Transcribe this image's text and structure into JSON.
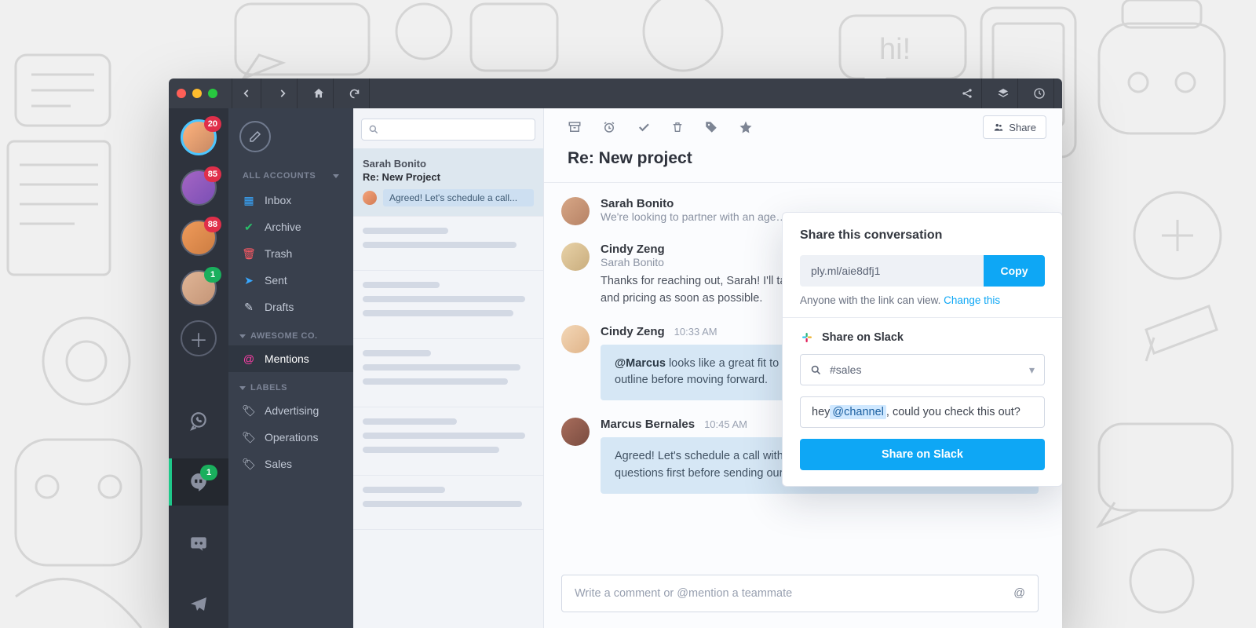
{
  "titlebar": {},
  "accounts": [
    {
      "badge": "20",
      "active": true
    },
    {
      "badge": "85"
    },
    {
      "badge": "88"
    },
    {
      "badge": "1",
      "badge_color": "green"
    }
  ],
  "integrations": [
    {
      "name": "whatsapp",
      "badge": null
    },
    {
      "name": "hangouts",
      "badge": "1",
      "active": true
    },
    {
      "name": "discord"
    },
    {
      "name": "telegram"
    }
  ],
  "nav": {
    "accounts_header": "ALL ACCOUNTS",
    "items": [
      {
        "icon": "inbox",
        "label": "Inbox"
      },
      {
        "icon": "archive",
        "label": "Archive"
      },
      {
        "icon": "trash",
        "label": "Trash"
      },
      {
        "icon": "sent",
        "label": "Sent"
      },
      {
        "icon": "drafts",
        "label": "Drafts"
      }
    ],
    "section1": {
      "title": "AWESOME CO.",
      "items": [
        {
          "icon": "mentions",
          "label": "Mentions",
          "active": true
        }
      ]
    },
    "section2": {
      "title": "LABELS",
      "items": [
        {
          "icon": "tag",
          "label": "Advertising"
        },
        {
          "icon": "tag",
          "label": "Operations"
        },
        {
          "icon": "tag",
          "label": "Sales"
        }
      ]
    }
  },
  "list": {
    "selected": {
      "from": "Sarah Bonito",
      "subject": "Re:  New Project",
      "chip": "Agreed! Let's schedule a call..."
    }
  },
  "content": {
    "subject": "Re: New project",
    "share_button": "Share",
    "messages": [
      {
        "name": "Sarah Bonito",
        "sub": "We're looking to partner with an age…"
      },
      {
        "name": "Cindy Zeng",
        "sub2": "Sarah Bonito",
        "body": "Thanks for reaching out, Sarah! I'll take a look and follow up with a sample timeline and pricing as soon as possible."
      },
      {
        "name": "Cindy Zeng",
        "time": "10:33 AM",
        "quote_html": "<b>@Marcus</b> looks like a great fit to me, take a look and let me know if we should outline before moving forward."
      },
      {
        "name": "Marcus Bernales",
        "time": "10:45 AM",
        "quote": "Agreed! Let's schedule a call with Sarah next week, I'd like to ask a few questions first before sending our proposal."
      }
    ],
    "compose_placeholder": "Write a comment or @mention a teammate"
  },
  "share": {
    "title": "Share this conversation",
    "link": "ply.ml/aie8dfj1",
    "copy": "Copy",
    "perm_prefix": "Anyone with the link can view. ",
    "perm_link": "Change this",
    "slack_header": "Share on Slack",
    "channel": "#sales",
    "msg_pre": "hey ",
    "msg_mention": "@channel",
    "msg_post": ", could you check this out?",
    "action": "Share on Slack"
  }
}
